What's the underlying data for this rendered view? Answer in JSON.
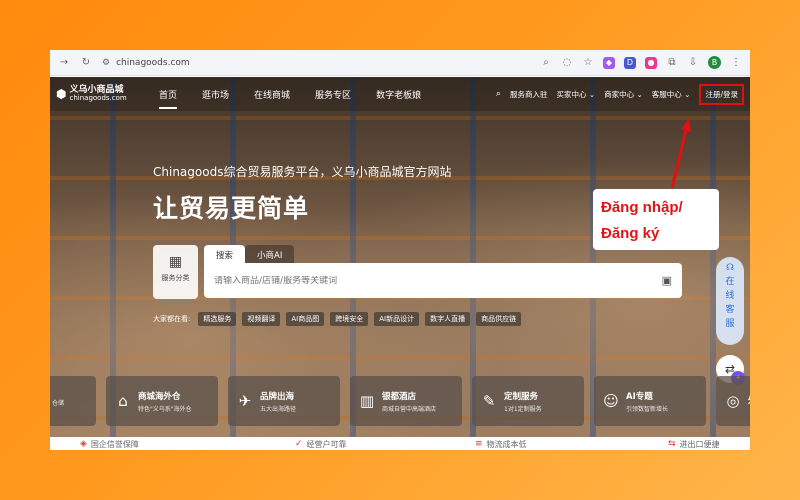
{
  "browser": {
    "url": "chinagoods.com",
    "profile_initial": "B"
  },
  "site": {
    "logo_cn": "义乌小商品城",
    "logo_en": "chinagoods.com",
    "nav": [
      "首页",
      "逛市场",
      "在线商城",
      "服务专区",
      "数字老板娘"
    ],
    "right_nav": [
      "服务商入驻",
      "买家中心 ⌄",
      "商家中心 ⌄",
      "客服中心 ⌄"
    ],
    "login": "注册/登录"
  },
  "hero": {
    "subtitle": "Chinagoods综合贸易服务平台，义乌小商品城官方网站",
    "title": "让贸易更简单"
  },
  "service_box": {
    "label": "服务分类"
  },
  "search": {
    "tabs": [
      "搜索",
      "小商AI"
    ],
    "placeholder": "请输入商品/店铺/服务等关键词"
  },
  "tags": {
    "hint": "大家都在看:",
    "items": [
      "精选服务",
      "视频翻译",
      "AI商品图",
      "跨境安全",
      "AI新品设计",
      "数字人直播",
      "商品供应链"
    ]
  },
  "float": {
    "cs_chars": [
      "在",
      "线",
      "客",
      "服"
    ]
  },
  "cards": [
    {
      "title": "",
      "sub": "仓储"
    },
    {
      "title": "商城海外仓",
      "sub": "特色\"义乌系\"海外仓"
    },
    {
      "title": "品牌出海",
      "sub": "五大出海路径"
    },
    {
      "title": "银都酒店",
      "sub": "商城自营中高端酒店"
    },
    {
      "title": "定制服务",
      "sub": "1对1定制服务"
    },
    {
      "title": "AI专题",
      "sub": "引领数智新增长"
    },
    {
      "title": "外",
      "sub": ""
    }
  ],
  "strip": [
    "国企信誉保障",
    "经营户可靠",
    "物流成本低",
    "进出口便捷"
  ],
  "annotation": {
    "line1": "Đăng nhập/",
    "line2": "Đăng ký"
  },
  "colors": {
    "background": "#ff9a1f",
    "highlight": "#e01010"
  }
}
